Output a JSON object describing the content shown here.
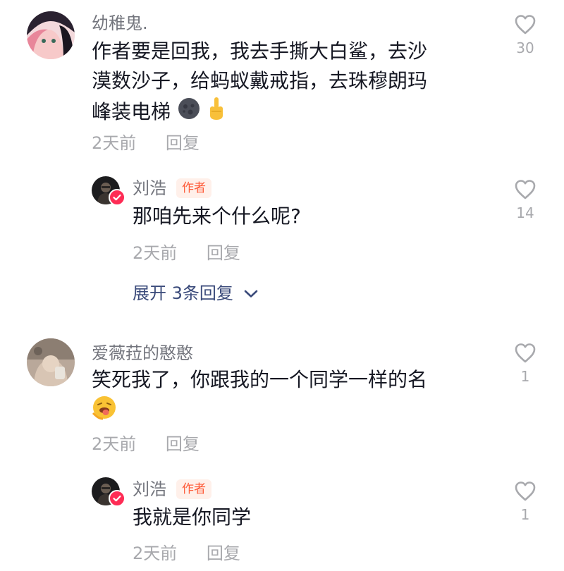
{
  "comments": [
    {
      "username": "幼稚鬼.",
      "lines": [
        "作者要是回我，我去手撕大白鲨，去沙",
        "漠数沙子，给蚂蚁戴戒指，去珠穆朗玛",
        "峰装电梯"
      ],
      "emojis": [
        "new-moon-face-emoji",
        "middle-finger-emoji"
      ],
      "time": "2天前",
      "reply_label": "回复",
      "like_count": "30",
      "reply": {
        "username": "刘浩",
        "author_tag": "作者",
        "text": "那咱先来个什么呢?",
        "time": "2天前",
        "reply_label": "回复",
        "like_count": "14"
      },
      "expand_label": "展开 3条回复"
    },
    {
      "username": "爱薇菈的憨憨",
      "lines": [
        "笑死我了，你跟我的一个同学一样的名"
      ],
      "emojis": [
        "tongue-out-emoji"
      ],
      "time": "2天前",
      "reply_label": "回复",
      "like_count": "1",
      "reply": {
        "username": "刘浩",
        "author_tag": "作者",
        "text": "我就是你同学",
        "time": "2天前",
        "reply_label": "回复",
        "like_count": "1"
      }
    }
  ],
  "colors": {
    "author_tag": "#fe5c3a",
    "verified_badge": "#fe2c55",
    "expand_link": "#3a4a7a"
  }
}
